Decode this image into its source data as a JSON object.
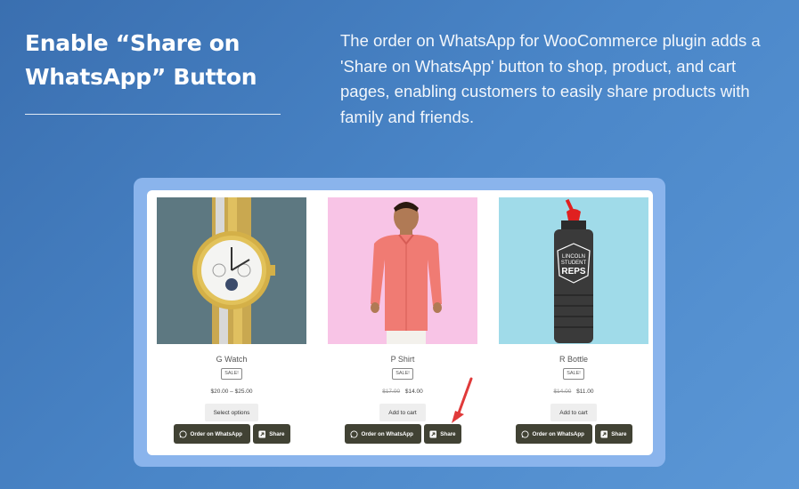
{
  "header": {
    "title_line1": "Enable “Share on",
    "title_line2": "WhatsApp” Button",
    "description": "The order on WhatsApp for WooCommerce plugin adds a 'Share on WhatsApp' button to shop, product, and cart pages, enabling customers to easily share products with family and friends."
  },
  "products": [
    {
      "name": "G Watch",
      "badge": "SALE!",
      "price_old": "",
      "price": "$20.00 – $25.00",
      "cart_label": "Select options",
      "wa_label": "Order on WhatsApp",
      "share_label": "Share",
      "image_icon": "watch-image"
    },
    {
      "name": "P Shirt",
      "badge": "SALE!",
      "price_old": "$17.00",
      "price": "$14.00",
      "cart_label": "Add to cart",
      "wa_label": "Order on WhatsApp",
      "share_label": "Share",
      "image_icon": "shirt-image"
    },
    {
      "name": "R Bottle",
      "badge": "SALE!",
      "price_old": "$14.00",
      "price": "$11.00",
      "cart_label": "Add to cart",
      "wa_label": "Order on WhatsApp",
      "share_label": "Share",
      "image_icon": "bottle-image",
      "bottle_print": [
        "LINCOLN",
        "STUDENT",
        "REPS"
      ]
    }
  ],
  "colors": {
    "background": "#4a86c8",
    "frame": "#8ab4ec",
    "button_dark": "#414234",
    "arrow": "#e03a3a"
  }
}
